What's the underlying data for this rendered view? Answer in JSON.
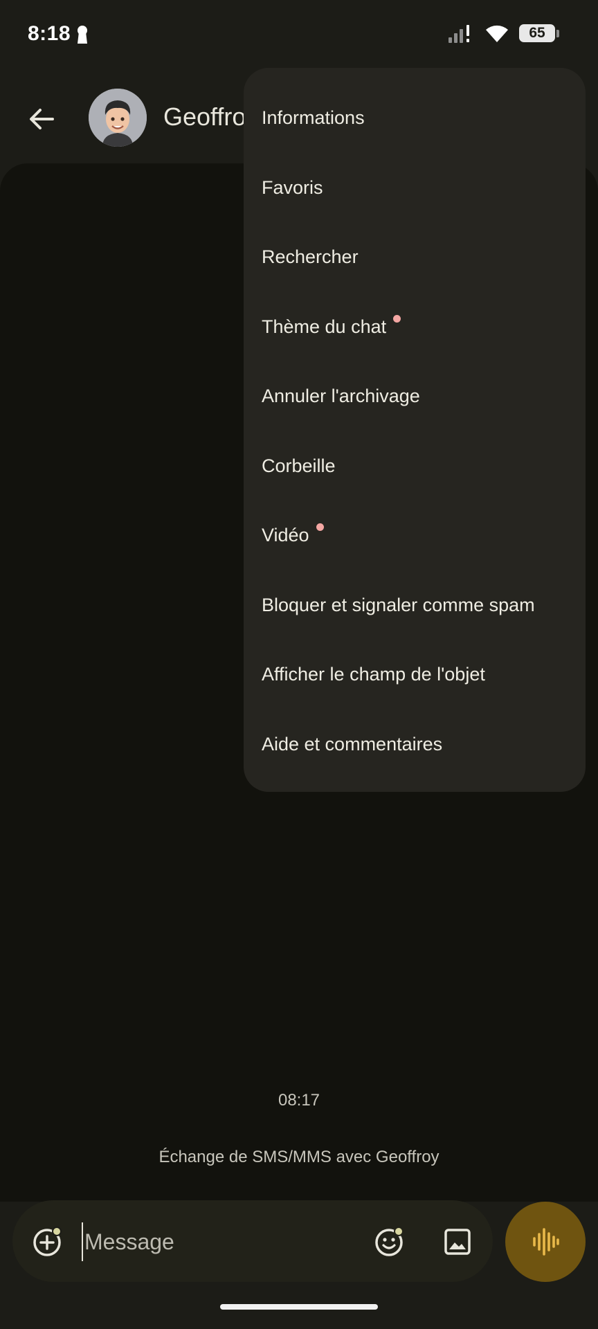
{
  "status_bar": {
    "time": "8:18",
    "battery_level": "65",
    "icons": [
      "keyhole-lock-icon",
      "signal-icon",
      "wifi-icon",
      "battery-icon"
    ]
  },
  "header": {
    "contact_name": "Geoffroy",
    "back_icon": "arrow-left-icon",
    "avatar_icon": "memoji-avatar"
  },
  "menu": {
    "items": [
      {
        "label": "Informations",
        "badge": false
      },
      {
        "label": "Favoris",
        "badge": false
      },
      {
        "label": "Rechercher",
        "badge": false
      },
      {
        "label": "Thème du chat",
        "badge": true
      },
      {
        "label": "Annuler l'archivage",
        "badge": false
      },
      {
        "label": "Corbeille",
        "badge": false
      },
      {
        "label": "Vidéo",
        "badge": true
      },
      {
        "label": "Bloquer et signaler comme spam",
        "badge": false
      },
      {
        "label": "Afficher le champ de l'objet",
        "badge": false
      },
      {
        "label": "Aide et commentaires",
        "badge": false
      }
    ],
    "badge_color": "#f4a7a3"
  },
  "conversation": {
    "timestamp": "08:17",
    "info": "Échange de SMS/MMS avec Geoffroy"
  },
  "composer": {
    "placeholder": "Message",
    "value": "",
    "icons": [
      "add-attachment-icon",
      "emoji-icon",
      "gallery-icon",
      "voice-waveform-icon"
    ]
  },
  "colors": {
    "background": "#1c1c17",
    "conversation_background": "#12120d",
    "menu_background": "#262520",
    "voice_button": "#6f5410",
    "accent_yellow": "#e9b94a",
    "notification_dot": "#d8d6a0"
  }
}
